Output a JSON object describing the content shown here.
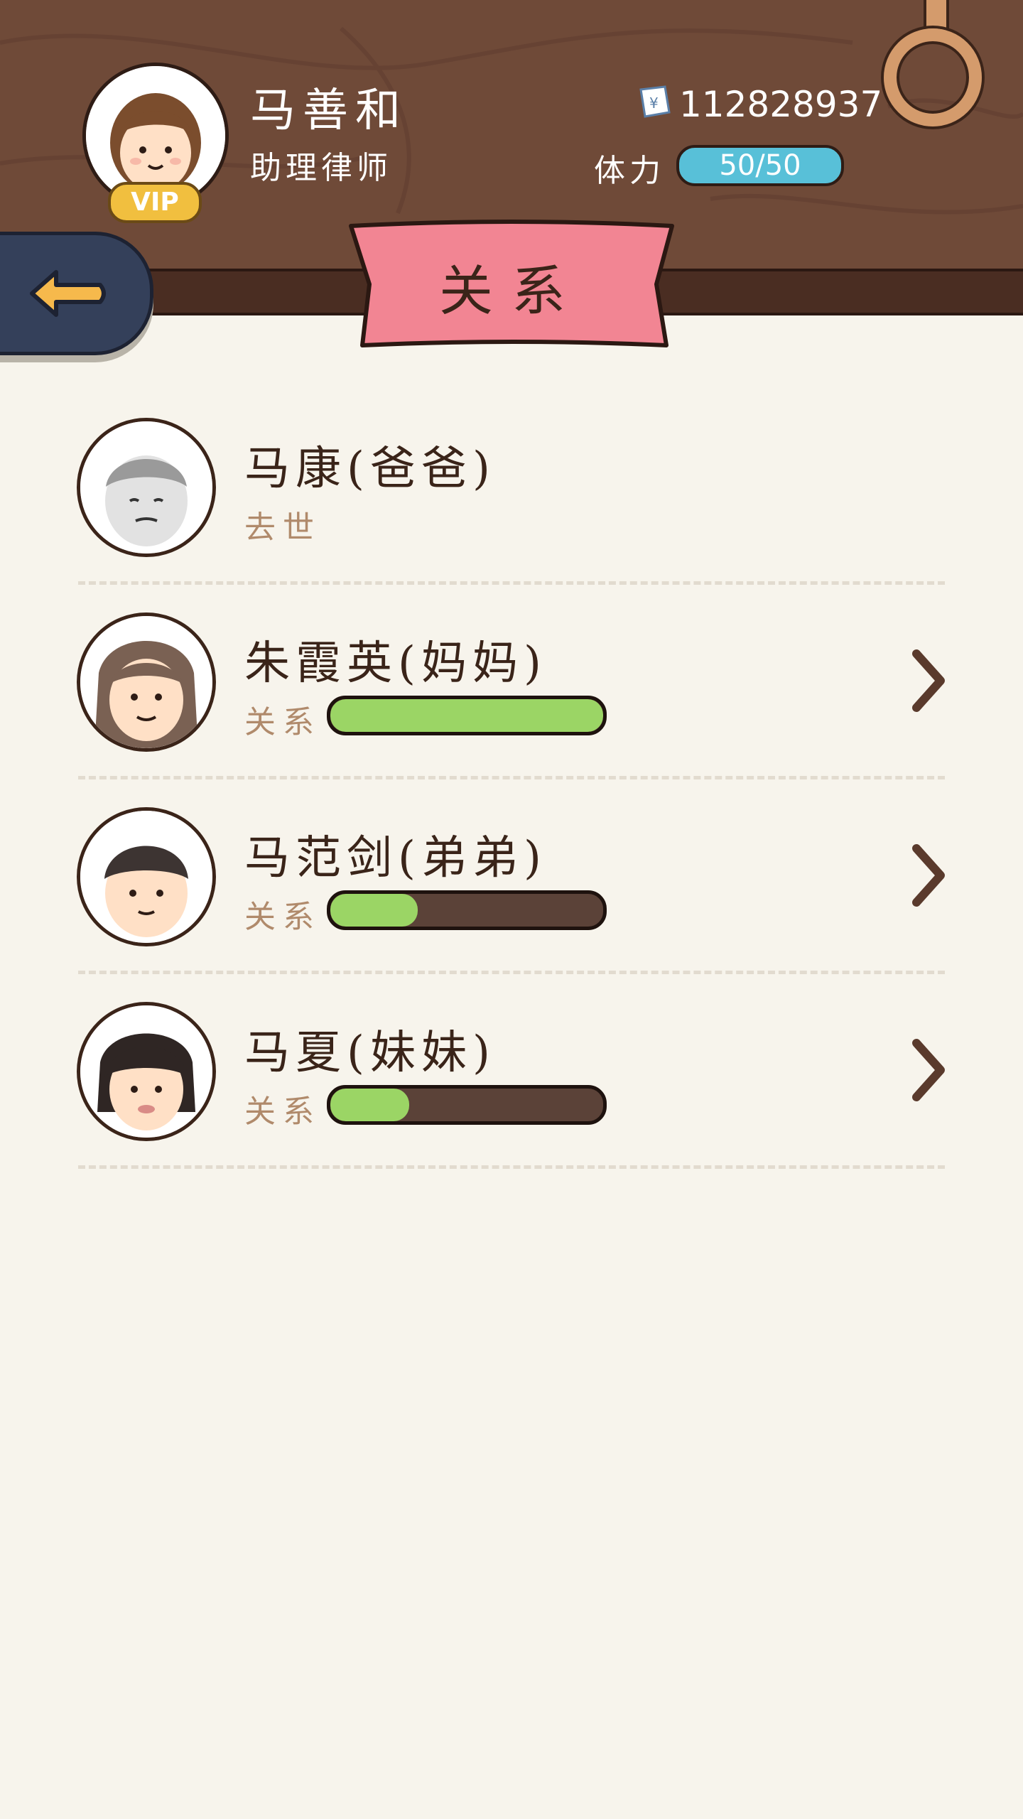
{
  "header": {
    "user_name": "马善和",
    "user_title": "助理律师",
    "vip_label": "VIP",
    "money": "112828937",
    "stamina_label": "体力",
    "stamina_value": "50/50"
  },
  "page": {
    "title": "关系"
  },
  "relations": [
    {
      "name": "马康(爸爸)",
      "status": "去世",
      "relation_label": "",
      "level": null,
      "navigable": false
    },
    {
      "name": "朱霞英(妈妈)",
      "status": "",
      "relation_label": "关系",
      "level": 1.0,
      "navigable": true
    },
    {
      "name": "马范剑(弟弟)",
      "status": "",
      "relation_label": "关系",
      "level": 0.32,
      "navigable": true
    },
    {
      "name": "马夏(妹妹)",
      "status": "",
      "relation_label": "关系",
      "level": 0.29,
      "navigable": true
    }
  ],
  "colors": {
    "header_wood": "#6f4a38",
    "banner": "#f28593",
    "relation_bar_fill": "#9bd565",
    "stamina_bar": "#58c0d8",
    "back_button": "#34405a",
    "background": "#f7f4ec"
  },
  "icons": {
    "back": "back-arrow-icon",
    "money": "money-bill-icon",
    "settings_ring": "ring-icon",
    "row_nav": "chevron-right-icon"
  }
}
